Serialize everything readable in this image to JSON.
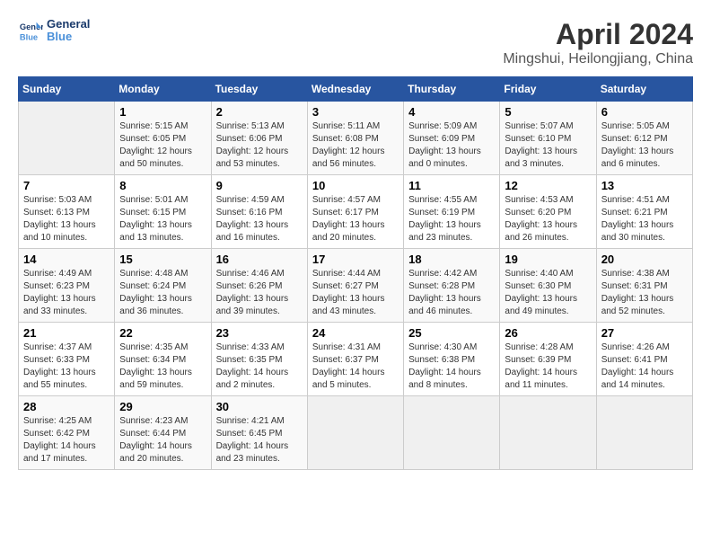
{
  "logo": {
    "line1": "General",
    "line2": "Blue"
  },
  "title": "April 2024",
  "subtitle": "Mingshui, Heilongjiang, China",
  "days_header": [
    "Sunday",
    "Monday",
    "Tuesday",
    "Wednesday",
    "Thursday",
    "Friday",
    "Saturday"
  ],
  "weeks": [
    [
      {
        "day": "",
        "info": ""
      },
      {
        "day": "1",
        "info": "Sunrise: 5:15 AM\nSunset: 6:05 PM\nDaylight: 12 hours\nand 50 minutes."
      },
      {
        "day": "2",
        "info": "Sunrise: 5:13 AM\nSunset: 6:06 PM\nDaylight: 12 hours\nand 53 minutes."
      },
      {
        "day": "3",
        "info": "Sunrise: 5:11 AM\nSunset: 6:08 PM\nDaylight: 12 hours\nand 56 minutes."
      },
      {
        "day": "4",
        "info": "Sunrise: 5:09 AM\nSunset: 6:09 PM\nDaylight: 13 hours\nand 0 minutes."
      },
      {
        "day": "5",
        "info": "Sunrise: 5:07 AM\nSunset: 6:10 PM\nDaylight: 13 hours\nand 3 minutes."
      },
      {
        "day": "6",
        "info": "Sunrise: 5:05 AM\nSunset: 6:12 PM\nDaylight: 13 hours\nand 6 minutes."
      }
    ],
    [
      {
        "day": "7",
        "info": "Sunrise: 5:03 AM\nSunset: 6:13 PM\nDaylight: 13 hours\nand 10 minutes."
      },
      {
        "day": "8",
        "info": "Sunrise: 5:01 AM\nSunset: 6:15 PM\nDaylight: 13 hours\nand 13 minutes."
      },
      {
        "day": "9",
        "info": "Sunrise: 4:59 AM\nSunset: 6:16 PM\nDaylight: 13 hours\nand 16 minutes."
      },
      {
        "day": "10",
        "info": "Sunrise: 4:57 AM\nSunset: 6:17 PM\nDaylight: 13 hours\nand 20 minutes."
      },
      {
        "day": "11",
        "info": "Sunrise: 4:55 AM\nSunset: 6:19 PM\nDaylight: 13 hours\nand 23 minutes."
      },
      {
        "day": "12",
        "info": "Sunrise: 4:53 AM\nSunset: 6:20 PM\nDaylight: 13 hours\nand 26 minutes."
      },
      {
        "day": "13",
        "info": "Sunrise: 4:51 AM\nSunset: 6:21 PM\nDaylight: 13 hours\nand 30 minutes."
      }
    ],
    [
      {
        "day": "14",
        "info": "Sunrise: 4:49 AM\nSunset: 6:23 PM\nDaylight: 13 hours\nand 33 minutes."
      },
      {
        "day": "15",
        "info": "Sunrise: 4:48 AM\nSunset: 6:24 PM\nDaylight: 13 hours\nand 36 minutes."
      },
      {
        "day": "16",
        "info": "Sunrise: 4:46 AM\nSunset: 6:26 PM\nDaylight: 13 hours\nand 39 minutes."
      },
      {
        "day": "17",
        "info": "Sunrise: 4:44 AM\nSunset: 6:27 PM\nDaylight: 13 hours\nand 43 minutes."
      },
      {
        "day": "18",
        "info": "Sunrise: 4:42 AM\nSunset: 6:28 PM\nDaylight: 13 hours\nand 46 minutes."
      },
      {
        "day": "19",
        "info": "Sunrise: 4:40 AM\nSunset: 6:30 PM\nDaylight: 13 hours\nand 49 minutes."
      },
      {
        "day": "20",
        "info": "Sunrise: 4:38 AM\nSunset: 6:31 PM\nDaylight: 13 hours\nand 52 minutes."
      }
    ],
    [
      {
        "day": "21",
        "info": "Sunrise: 4:37 AM\nSunset: 6:33 PM\nDaylight: 13 hours\nand 55 minutes."
      },
      {
        "day": "22",
        "info": "Sunrise: 4:35 AM\nSunset: 6:34 PM\nDaylight: 13 hours\nand 59 minutes."
      },
      {
        "day": "23",
        "info": "Sunrise: 4:33 AM\nSunset: 6:35 PM\nDaylight: 14 hours\nand 2 minutes."
      },
      {
        "day": "24",
        "info": "Sunrise: 4:31 AM\nSunset: 6:37 PM\nDaylight: 14 hours\nand 5 minutes."
      },
      {
        "day": "25",
        "info": "Sunrise: 4:30 AM\nSunset: 6:38 PM\nDaylight: 14 hours\nand 8 minutes."
      },
      {
        "day": "26",
        "info": "Sunrise: 4:28 AM\nSunset: 6:39 PM\nDaylight: 14 hours\nand 11 minutes."
      },
      {
        "day": "27",
        "info": "Sunrise: 4:26 AM\nSunset: 6:41 PM\nDaylight: 14 hours\nand 14 minutes."
      }
    ],
    [
      {
        "day": "28",
        "info": "Sunrise: 4:25 AM\nSunset: 6:42 PM\nDaylight: 14 hours\nand 17 minutes."
      },
      {
        "day": "29",
        "info": "Sunrise: 4:23 AM\nSunset: 6:44 PM\nDaylight: 14 hours\nand 20 minutes."
      },
      {
        "day": "30",
        "info": "Sunrise: 4:21 AM\nSunset: 6:45 PM\nDaylight: 14 hours\nand 23 minutes."
      },
      {
        "day": "",
        "info": ""
      },
      {
        "day": "",
        "info": ""
      },
      {
        "day": "",
        "info": ""
      },
      {
        "day": "",
        "info": ""
      }
    ]
  ]
}
